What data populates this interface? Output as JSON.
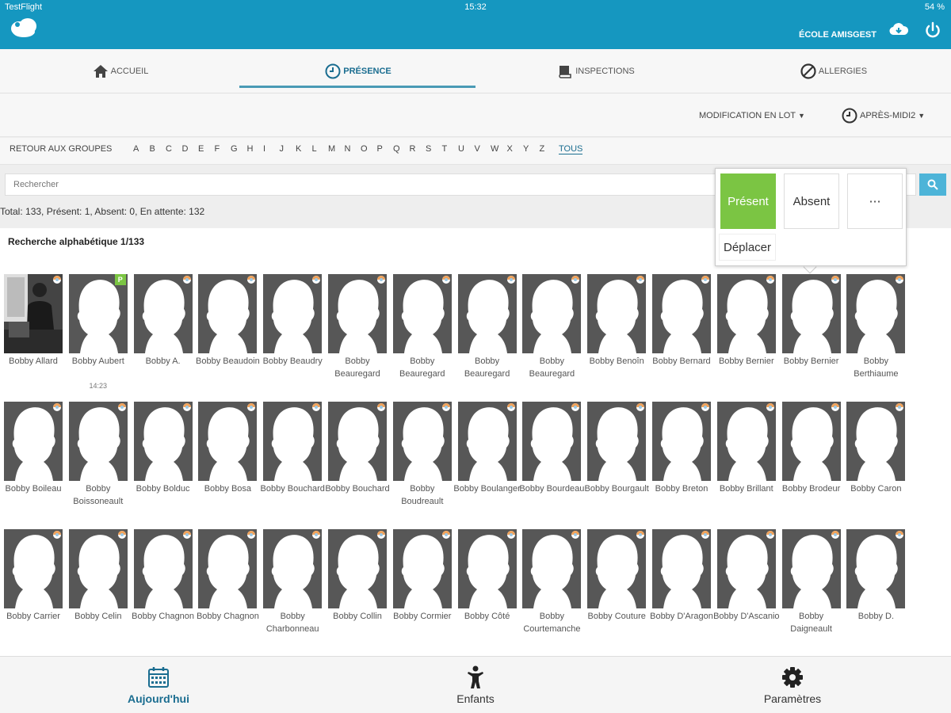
{
  "status_bar": {
    "carrier": "TestFlight",
    "time": "15:32",
    "battery": "54 %"
  },
  "header": {
    "school_name": "ÉCOLE AMISGEST"
  },
  "tabs": [
    {
      "label": "ACCUEIL",
      "icon": "home-icon"
    },
    {
      "label": "PRÉSENCE",
      "icon": "clock-icon",
      "active": true
    },
    {
      "label": "INSPECTIONS",
      "icon": "book-icon"
    },
    {
      "label": "ALLERGIES",
      "icon": "ban-icon"
    }
  ],
  "toolbar": {
    "batch_label": "MODIFICATION EN LOT",
    "period_label": "APRÈS-MIDI2"
  },
  "alphabet": {
    "back_label": "RETOUR AUX GROUPES",
    "letters": [
      "A",
      "B",
      "C",
      "D",
      "E",
      "F",
      "G",
      "H",
      "I",
      "J",
      "K",
      "L",
      "M",
      "N",
      "O",
      "P",
      "Q",
      "R",
      "S",
      "T",
      "U",
      "V",
      "W",
      "X",
      "Y",
      "Z"
    ],
    "all_label": "TOUS"
  },
  "search": {
    "placeholder": "Rechercher"
  },
  "stats": "Total: 133, Présent: 1, Absent: 0, En attente: 132",
  "content": {
    "title": "Recherche alphabétique 1/133"
  },
  "children": [
    {
      "name": "Bobby Allard",
      "photo": true
    },
    {
      "name": "Bobby Aubert",
      "status": "P",
      "time": "14:23"
    },
    {
      "name": "Bobby A."
    },
    {
      "name": "Bobby Beaudoin"
    },
    {
      "name": "Bobby Beaudry"
    },
    {
      "name": "Bobby Beauregard"
    },
    {
      "name": "Bobby Beauregard"
    },
    {
      "name": "Bobby Beauregard"
    },
    {
      "name": "Bobby Beauregard"
    },
    {
      "name": "Bobby Benoîn"
    },
    {
      "name": "Bobby Bernard"
    },
    {
      "name": "Bobby Bernier"
    },
    {
      "name": "Bobby Bernier"
    },
    {
      "name": "Bobby Berthiaume"
    },
    {
      "name": "Bobby Boileau"
    },
    {
      "name": "Bobby Boissoneault"
    },
    {
      "name": "Bobby Bolduc"
    },
    {
      "name": "Bobby Bosa"
    },
    {
      "name": "Bobby Bouchard"
    },
    {
      "name": "Bobby Bouchard"
    },
    {
      "name": "Bobby Boudreault"
    },
    {
      "name": "Bobby Boulanger"
    },
    {
      "name": "Bobby Bourdeau"
    },
    {
      "name": "Bobby Bourgault"
    },
    {
      "name": "Bobby Breton"
    },
    {
      "name": "Bobby Brillant"
    },
    {
      "name": "Bobby Brodeur"
    },
    {
      "name": "Bobby Caron"
    },
    {
      "name": "Bobby Carrier"
    },
    {
      "name": "Bobby Celin"
    },
    {
      "name": "Bobby Chagnon"
    },
    {
      "name": "Bobby Chagnon"
    },
    {
      "name": "Bobby Charbonneau"
    },
    {
      "name": "Bobby Collin"
    },
    {
      "name": "Bobby Cormier"
    },
    {
      "name": "Bobby Côté"
    },
    {
      "name": "Bobby Courtemanche"
    },
    {
      "name": "Bobby Couture"
    },
    {
      "name": "Bobby D'Aragon"
    },
    {
      "name": "Bobby D'Ascanio"
    },
    {
      "name": "Bobby Daigneault"
    },
    {
      "name": "Bobby D."
    }
  ],
  "popover": {
    "present_label": "Présent",
    "absent_label": "Absent",
    "more_label": "⋯",
    "move_label": "Déplacer"
  },
  "bottom_nav": [
    {
      "label": "Aujourd'hui",
      "icon": "calendar-icon",
      "active": true
    },
    {
      "label": "Enfants",
      "icon": "child-icon"
    },
    {
      "label": "Paramètres",
      "icon": "gear-icon"
    }
  ],
  "colors": {
    "primary": "#1597c0",
    "present": "#7bc543",
    "active_text": "#1a6d90"
  }
}
